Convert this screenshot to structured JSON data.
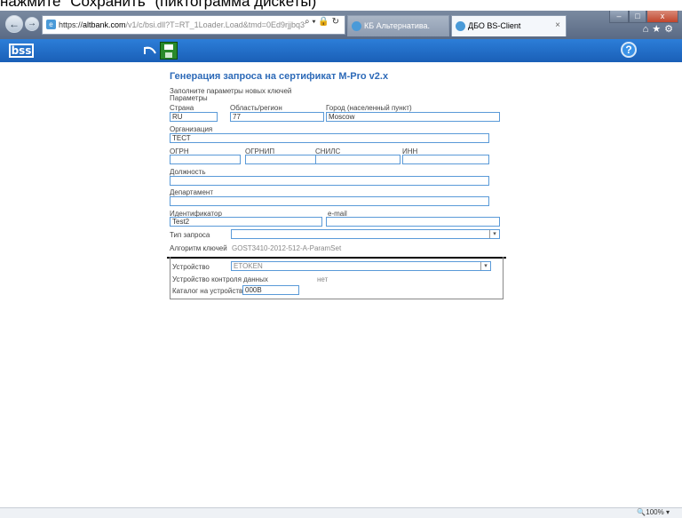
{
  "caption": "нажмите \"Сохранить\" (пиктограмма дискеты)",
  "browser": {
    "url_host": "altbank.com",
    "url_path": "/v1/c/bsi.dll?T=RT_1Loader.Load&tmd=0Ed9rjjbq3",
    "url_scheme": "https://",
    "tab1_title": "КБ Альтернатива.",
    "tab2_title": "ДБО BS-Client",
    "tab_close": "×",
    "addr_tools": "⌕ ▾ 🔒 ↻",
    "zoom": "100%",
    "zoom_icon": "zoom-icon",
    "colors": {
      "toolbar": "#1f6fcd",
      "chrome": "#6a7a94",
      "accent": "#2d6ab8"
    }
  },
  "app": {
    "logo": "ᗷᔕᔕ"
  },
  "form": {
    "title": "Генерация запроса на сертификат M-Pro v2.x",
    "instruction": "Заполните параметры новых ключей",
    "params_label": "Параметры",
    "country_label": "Страна",
    "country_value": "RU",
    "region_label": "Область/регион",
    "region_value": "77",
    "city_label": "Город (населенный пункт)",
    "city_value": "Moscow",
    "org_label": "Организация",
    "org_value": "ТЕСТ",
    "ogrn_label": "ОГРН",
    "ogrn_value": "",
    "ogrnip_label": "ОГРНИП",
    "ogrnip_value": "",
    "snils_label": "СНИЛС",
    "snils_value": "",
    "inn_label": "ИНН",
    "inn_value": "",
    "position_label": "Должность",
    "position_value": "",
    "department_label": "Департамент",
    "department_value": "",
    "identifier_label": "Идентификатор",
    "identifier_value": "Test2",
    "email_label": "e-mail",
    "email_value": "",
    "request_type_label": "Тип запроса",
    "request_type_value": "",
    "algorithm_label": "Алгоритм ключей",
    "algorithm_value": "GOST3410-2012-512-A-ParamSet",
    "device_label": "Устройство",
    "device_value": "ETOKEN",
    "control_device_label": "Устройство контроля данных",
    "control_device_value": "нет",
    "catalog_label": "Каталог на устройстве",
    "catalog_value": "000B"
  }
}
